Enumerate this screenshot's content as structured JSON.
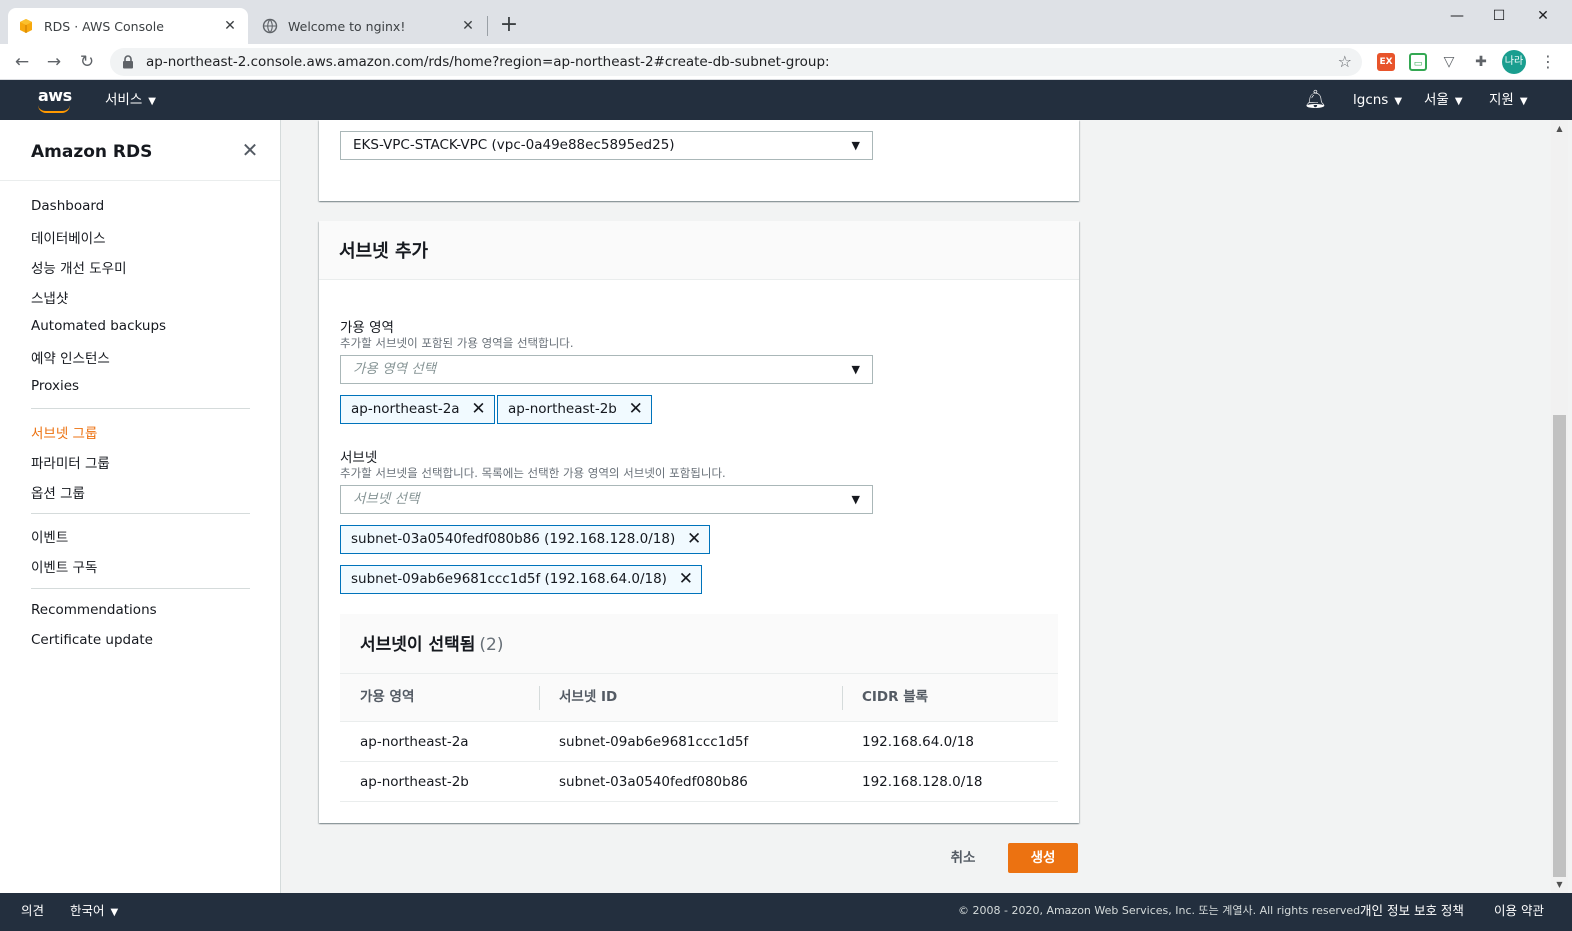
{
  "browser": {
    "tabs": [
      {
        "title": "RDS · AWS Console",
        "active": true
      },
      {
        "title": "Welcome to nginx!",
        "active": false
      }
    ],
    "new_tab": "+",
    "url": "ap-northeast-2.console.aws.amazon.com/rds/home?region=ap-northeast-2#create-db-subnet-group:",
    "profile_initials": "나라",
    "icons": {
      "back": "back-arrow-icon",
      "forward": "forward-arrow-icon",
      "reload": "reload-icon",
      "lock": "lock-icon",
      "star": "star-icon"
    }
  },
  "aws_header": {
    "logo": "aws",
    "services": "서비스",
    "account": "lgcns",
    "region": "서울",
    "support": "지원"
  },
  "sidebar": {
    "title": "Amazon RDS",
    "groups": [
      [
        "Dashboard",
        "데이터베이스",
        "성능 개선 도우미",
        "스냅샷",
        "Automated backups",
        "예약 인스턴스",
        "Proxies"
      ],
      [
        "서브넷 그룹",
        "파라미터 그룹",
        "옵션 그룹"
      ],
      [
        "이벤트",
        "이벤트 구독"
      ],
      [
        "Recommendations",
        "Certificate update"
      ]
    ],
    "active_item": "서브넷 그룹"
  },
  "vpc": {
    "selected": "EKS-VPC-STACK-VPC (vpc-0a49e88ec5895ed25)"
  },
  "add_subnets": {
    "title": "서브넷 추가",
    "az_label": "가용 영역",
    "az_desc": "추가할 서브넷이 포함된 가용 영역을 선택합니다.",
    "az_placeholder": "가용 영역 선택",
    "az_tokens": [
      "ap-northeast-2a",
      "ap-northeast-2b"
    ],
    "subnet_label": "서브넷",
    "subnet_desc": "추가할 서브넷을 선택합니다. 목록에는 선택한 가용 영역의 서브넷이 포함됩니다.",
    "subnet_placeholder": "서브넷 선택",
    "subnet_tokens": [
      "subnet-03a0540fedf080b86 (192.168.128.0/18)",
      "subnet-09ab6e9681ccc1d5f (192.168.64.0/18)"
    ]
  },
  "selected_subnets": {
    "title": "서브넷이 선택됨",
    "count": "(2)",
    "columns": [
      "가용 영역",
      "서브넷 ID",
      "CIDR 블록"
    ],
    "rows": [
      [
        "ap-northeast-2a",
        "subnet-09ab6e9681ccc1d5f",
        "192.168.64.0/18"
      ],
      [
        "ap-northeast-2b",
        "subnet-03a0540fedf080b86",
        "192.168.128.0/18"
      ]
    ]
  },
  "actions": {
    "cancel": "취소",
    "create": "생성"
  },
  "footer": {
    "feedback": "의견",
    "language": "한국어",
    "copyright": "© 2008 - 2020, Amazon Web Services, Inc. 또는 계열사. All rights reserved.",
    "privacy": "개인 정보 보호 정책",
    "terms": "이용 약관"
  },
  "colors": {
    "accent": "#ec7211",
    "nav_bg": "#232f3e",
    "token_border": "#0073bb"
  }
}
